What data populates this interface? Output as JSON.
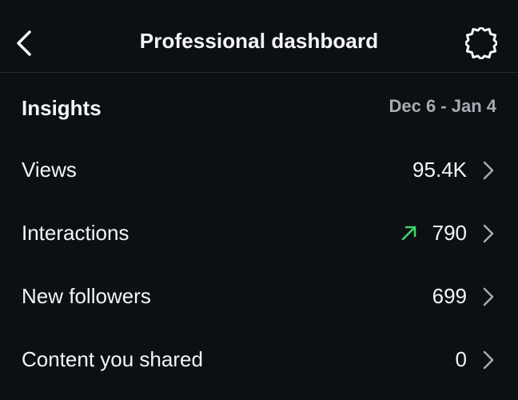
{
  "header": {
    "title": "Professional dashboard",
    "back_icon": "chevron-left-icon",
    "settings_icon": "gear-icon"
  },
  "insights": {
    "title": "Insights",
    "date_range": "Dec 6 - Jan 4"
  },
  "rows": [
    {
      "label": "Views",
      "value": "95.4K"
    },
    {
      "label": "Interactions",
      "value": "790",
      "trend": "up",
      "trend_color": "#3fd36b"
    },
    {
      "label": "New followers",
      "value": "699"
    },
    {
      "label": "Content you shared",
      "value": "0"
    }
  ],
  "colors": {
    "background": "#0c1014",
    "text": "#f5f5f5",
    "muted": "#a8acb2",
    "trend_up": "#3fd36b"
  }
}
